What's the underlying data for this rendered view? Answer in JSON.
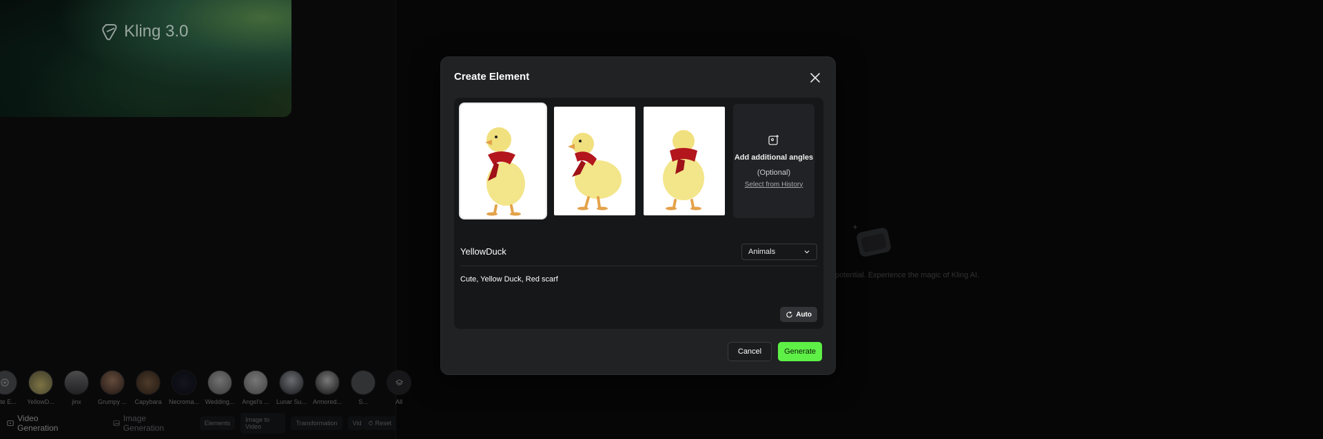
{
  "banner": {
    "logo_text": "Kling 3.0"
  },
  "elements_row": {
    "items": [
      {
        "label": "eate E...",
        "icon": "create-element-icon"
      },
      {
        "label": "YellowD..."
      },
      {
        "label": "jinx"
      },
      {
        "label": "Grumpy ..."
      },
      {
        "label": "Capybara"
      },
      {
        "label": "Necroma..."
      },
      {
        "label": "Wedding..."
      },
      {
        "label": "Angel's ..."
      },
      {
        "label": "Lunar Su..."
      },
      {
        "label": "Armored..."
      },
      {
        "label": "S..."
      },
      {
        "label": "All",
        "icon": "layers-icon"
      }
    ]
  },
  "bottom_tabs": {
    "video_generation": "Video Generation",
    "image_generation": "Image Generation",
    "chips": [
      "Elements",
      "Image to Video",
      "Transformation",
      "Vid"
    ],
    "reset": "Reset"
  },
  "placeholder": {
    "text": "potential. Experience the magic of Kling AI."
  },
  "modal": {
    "title": "Create Element",
    "add_angles": {
      "title": "Add additional angles",
      "optional": "(Optional)",
      "link": "Select from History"
    },
    "name": "YellowDuck",
    "category": {
      "selected": "Animals"
    },
    "description": "Cute, Yellow Duck, Red scarf",
    "auto_label": "Auto",
    "cancel_label": "Cancel",
    "generate_label": "Generate"
  },
  "colors": {
    "accent": "#5ef046",
    "modal_bg": "#212224",
    "scarf": "#b3161c",
    "duck": "#f3e58a"
  }
}
